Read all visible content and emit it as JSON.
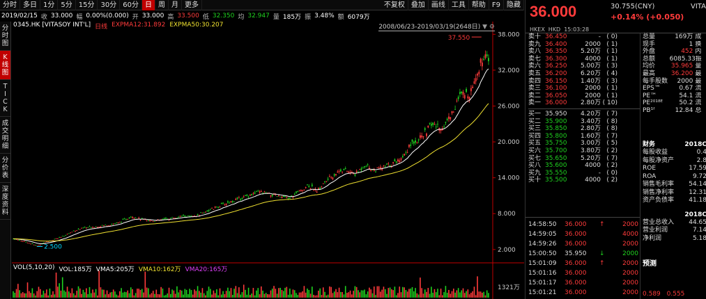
{
  "toolbar": {
    "items": [
      "分时",
      "多日",
      "1分",
      "5分",
      "15分",
      "30分",
      "60分",
      "日",
      "周",
      "月",
      "更多"
    ],
    "active_index": 7,
    "right_items": [
      "不复权",
      "叠加",
      "画线",
      "工具",
      "帮助",
      "F9",
      "隐藏"
    ]
  },
  "infobar": {
    "date": "2019/02/15",
    "chg_label": "收",
    "chg_value": "33.000",
    "amp_label": "幅",
    "amp_value": "0.00%(0.000)",
    "open_label": "开",
    "open_value": "33.000",
    "high_label": "高",
    "high_value": "33.500",
    "low_label": "低",
    "low_value": "32.350",
    "avg_label": "均",
    "avg_value": "32.947",
    "vol_label": "量",
    "vol_value": "185万",
    "swing_label": "振",
    "swing_value": "3.48%",
    "amt_label": "额",
    "amt_value": "6079万"
  },
  "sidebar": {
    "tabs": [
      "分时图",
      "K线图",
      "TICK",
      "成交明细",
      "分价表",
      "深度资料"
    ],
    "active_index": 1
  },
  "chart_legend": {
    "code": "0345.HK [VITASOY INT'L]",
    "period": "日线",
    "ema12": "EXPMA12:31.892",
    "ema50": "EXPMA50:30.207",
    "range": "2008/06/23-2019/03/19(2648日)"
  },
  "volume_legend": {
    "label": "VOL(5,10,20)",
    "vol": "VOL:185万",
    "vma5": "VMA5:205万",
    "vma10": "VMA10:162万",
    "vma20": "VMA20:165万",
    "axis_label": "1321万"
  },
  "chart_data": {
    "type": "candlestick",
    "y_ticks": [
      "38.000",
      "32.000",
      "26.000",
      "20.000",
      "14.000",
      "8.000",
      "2.000"
    ],
    "y_tick_values": [
      38,
      32,
      26,
      20,
      14,
      8,
      2
    ],
    "ylim": [
      0,
      39.2
    ],
    "max_label": "37.550",
    "min_label": "2.500",
    "price_x": [
      0,
      0.03,
      0.05,
      0.07,
      0.1,
      0.13,
      0.15,
      0.19,
      0.22,
      0.25,
      0.27,
      0.3,
      0.33,
      0.36,
      0.38,
      0.4,
      0.42,
      0.45,
      0.48,
      0.5,
      0.52,
      0.55,
      0.58,
      0.6,
      0.62,
      0.64,
      0.66,
      0.69,
      0.72,
      0.74,
      0.76,
      0.78,
      0.8,
      0.82,
      0.84,
      0.86,
      0.88,
      0.9,
      0.92,
      0.94,
      0.96,
      0.975,
      0.99,
      1.0
    ],
    "price_y": [
      3.8,
      3.2,
      2.6,
      3.3,
      4.0,
      5.2,
      5.6,
      6.0,
      6.4,
      7.6,
      7.0,
      6.8,
      7.2,
      7.6,
      7.4,
      8.2,
      8.8,
      9.8,
      10.6,
      11.2,
      11.6,
      11.0,
      10.5,
      11.6,
      12.8,
      11.8,
      13.6,
      15.4,
      14.6,
      16.2,
      15.2,
      15.8,
      16.4,
      17.6,
      20.0,
      20.8,
      23.0,
      22.2,
      24.4,
      27.6,
      28.2,
      31.2,
      34.6,
      33.0
    ]
  },
  "quote": {
    "price": "36.000",
    "cny": "30.755(CNY)",
    "name": "VITASOY",
    "change": "+0.14% (+0.050)",
    "exchange": "HKEX",
    "currency": "HKD",
    "time": "15:03:28"
  },
  "order_book": {
    "asks": [
      {
        "n": "卖十",
        "p": "36.450",
        "v": "-",
        "c": "( 0)"
      },
      {
        "n": "卖九",
        "p": "36.400",
        "v": "2000",
        "c": "( 1)"
      },
      {
        "n": "卖八",
        "p": "36.350",
        "v": "5.20万",
        "c": "( 1)"
      },
      {
        "n": "卖七",
        "p": "36.300",
        "v": "4000",
        "c": "( 1)"
      },
      {
        "n": "卖六",
        "p": "36.250",
        "v": "5.00万",
        "c": "( 3)"
      },
      {
        "n": "卖五",
        "p": "36.200",
        "v": "6.20万",
        "c": "( 4)"
      },
      {
        "n": "卖四",
        "p": "36.150",
        "v": "1.40万",
        "c": "( 3)"
      },
      {
        "n": "卖三",
        "p": "36.100",
        "v": "2000",
        "c": "( 1)"
      },
      {
        "n": "卖二",
        "p": "36.050",
        "v": "2000",
        "c": "( 1)"
      },
      {
        "n": "卖一",
        "p": "36.000",
        "v": "2.80万",
        "c": "( 10)"
      }
    ],
    "bids": [
      {
        "n": "买一",
        "p": "35.950",
        "v": "4.20万",
        "c": "( 7)"
      },
      {
        "n": "买二",
        "p": "35.900",
        "v": "3.40万",
        "c": "( 8)"
      },
      {
        "n": "买三",
        "p": "35.850",
        "v": "2.80万",
        "c": "( 8)"
      },
      {
        "n": "买四",
        "p": "35.800",
        "v": "1.60万",
        "c": "( 7)"
      },
      {
        "n": "买五",
        "p": "35.750",
        "v": "3.00万",
        "c": "( 5)"
      },
      {
        "n": "买六",
        "p": "35.700",
        "v": "3.80万",
        "c": "( 2)"
      },
      {
        "n": "买七",
        "p": "35.650",
        "v": "5.20万",
        "c": "( 7)"
      },
      {
        "n": "买八",
        "p": "35.600",
        "v": "4000",
        "c": "( 2)"
      },
      {
        "n": "买九",
        "p": "35.550",
        "v": "-",
        "c": "( 0)"
      },
      {
        "n": "买十",
        "p": "35.500",
        "v": "4000",
        "c": "( 2)"
      }
    ]
  },
  "stats": [
    {
      "k": "总量",
      "v": "169万",
      "k2": "成",
      "vc": "#ddd"
    },
    {
      "k": "现手",
      "v": "1",
      "k2": "换",
      "vc": "#ddd"
    },
    {
      "k": "外盘",
      "v": "452",
      "k2": "内",
      "vc": "#ff3b3b"
    },
    {
      "k": "总额",
      "v": "6085.33",
      "k2": "振",
      "vc": "#ddd"
    },
    {
      "k": "均价",
      "v": "35.965",
      "k2": "量",
      "vc": "#ff3b3b"
    },
    {
      "k": "最高",
      "v": "36.200",
      "k2": "最",
      "vc": "#ff3b3b"
    },
    {
      "k": "每手股数",
      "v": "2000",
      "k2": "最",
      "vc": "#ddd"
    },
    {
      "k": "EPS™",
      "v": "0.67",
      "k2": "流",
      "vc": "#ddd"
    },
    {
      "k": "PE™",
      "v": "54.1",
      "k2": "流",
      "vc": "#ddd"
    },
    {
      "k": "PE²⁰¹⁸ᴱ",
      "v": "50.2",
      "k2": "流",
      "vc": "#ddd"
    },
    {
      "k": "PB¹ᶠ",
      "v": "12.84",
      "k2": "总",
      "vc": "#ddd"
    }
  ],
  "finance": {
    "title": "财务",
    "year": "2018C",
    "rows": [
      {
        "k": "每股收益",
        "v": "0.4"
      },
      {
        "k": "每股净资产",
        "v": "2.8"
      },
      {
        "k": "ROE",
        "v": "17.59"
      },
      {
        "k": "ROA",
        "v": "9.72"
      },
      {
        "k": "销售毛利率",
        "v": "54.14"
      },
      {
        "k": "销售净利率",
        "v": "12.31"
      },
      {
        "k": "资产负债率",
        "v": "41.18"
      }
    ],
    "year2": "2018C",
    "rows2": [
      {
        "k": "营业总收入",
        "v": "44.65"
      },
      {
        "k": "营业利润",
        "v": "7.14"
      },
      {
        "k": "净利润",
        "v": "5.18"
      }
    ],
    "predict": "预测",
    "predict_vals": [
      "0.589",
      "0.555"
    ]
  },
  "ticks": [
    {
      "t": "14:58:50",
      "p": "36.000",
      "a": "↑",
      "v": "2000",
      "pc": "#ff3b3b",
      "vc": "#ff3b3b"
    },
    {
      "t": "14:59:05",
      "p": "36.000",
      "a": "",
      "v": "4000",
      "pc": "#ff3b3b",
      "vc": "#ff3b3b"
    },
    {
      "t": "14:59:26",
      "p": "36.000",
      "a": "",
      "v": "2000",
      "pc": "#ff3b3b",
      "vc": "#ff3b3b"
    },
    {
      "t": "15:00:50",
      "p": "35.950",
      "a": "↓",
      "v": "2000",
      "pc": "#ddd",
      "vc": "#1fd31f"
    },
    {
      "t": "15:01:09",
      "p": "36.000",
      "a": "↑",
      "v": "2000",
      "pc": "#ff3b3b",
      "vc": "#ff3b3b"
    },
    {
      "t": "15:01:16",
      "p": "36.000",
      "a": "",
      "v": "2000",
      "pc": "#ff3b3b",
      "vc": "#ff3b3b"
    },
    {
      "t": "15:01:17",
      "p": "36.000",
      "a": "",
      "v": "2000",
      "pc": "#ff3b3b",
      "vc": "#ff3b3b"
    },
    {
      "t": "15:01:21",
      "p": "36.000",
      "a": "",
      "v": "2000",
      "pc": "#ff3b3b",
      "vc": "#ff3b3b"
    }
  ]
}
